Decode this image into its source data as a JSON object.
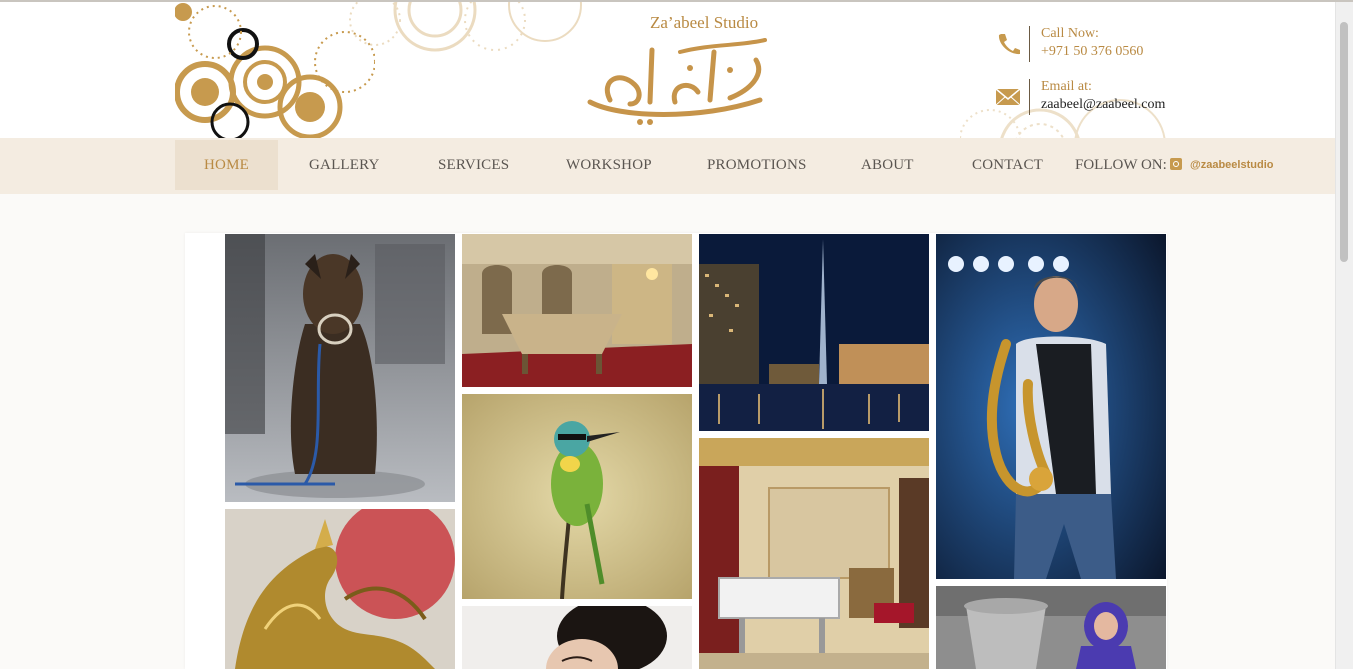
{
  "header": {
    "logo_text": "Za’abeel Studio",
    "logo_icon": "zaabeel-arabic-calligraphy-logo",
    "call": {
      "label": "Call Now:",
      "value": "+971 50 376 0560",
      "icon": "phone-icon"
    },
    "email": {
      "label": "Email at:",
      "value": "zaabeel@zaabeel.com",
      "icon": "envelope-icon"
    }
  },
  "nav": {
    "items": [
      {
        "label": "HOME",
        "active": true
      },
      {
        "label": "GALLERY"
      },
      {
        "label": "SERVICES"
      },
      {
        "label": "WORKSHOP"
      },
      {
        "label": "PROMOTIONS"
      },
      {
        "label": "ABOUT"
      },
      {
        "label": "CONTACT"
      }
    ],
    "follow_label": "FOLLOW ON:",
    "instagram_handle": "@zaabeelstudio"
  },
  "gallery": {
    "photos": [
      {
        "name": "dog-photo",
        "subject": "dog with muzzle on wet street"
      },
      {
        "name": "dining-room-photo",
        "subject": "ornate dining room"
      },
      {
        "name": "dubai-skyline-photo",
        "subject": "Burj Khalifa at night"
      },
      {
        "name": "saxophonist-photo",
        "subject": "man playing saxophone"
      },
      {
        "name": "bird-photo",
        "subject": "green bee-eater on branch"
      },
      {
        "name": "horse-statue-photo",
        "subject": "golden horse sculpture"
      },
      {
        "name": "hospital-room-photo",
        "subject": "luxury hospital room"
      },
      {
        "name": "portrait-photo",
        "subject": "woman portrait"
      },
      {
        "name": "child-photo",
        "subject": "child in purple hoodie"
      }
    ]
  },
  "colors": {
    "accent": "#b98a43",
    "nav_bg": "#f4ece1",
    "nav_active_bg": "#ece0cf",
    "text": "#5a5550"
  }
}
